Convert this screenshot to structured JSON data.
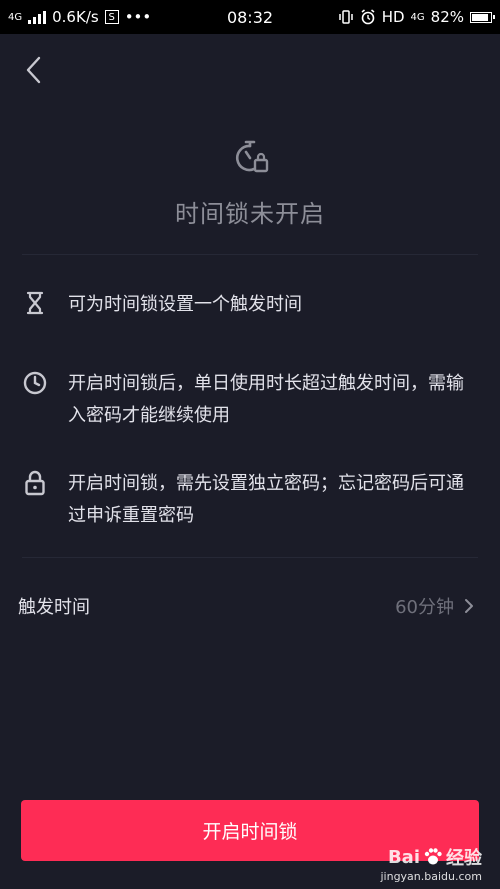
{
  "status_bar": {
    "network_left": "4G",
    "speed": "0.6K/s",
    "sim_icon_text": "S",
    "more": "•••",
    "time": "08:32",
    "hd": "HD",
    "network_right": "4G",
    "battery": "82%"
  },
  "header": {
    "back_icon": "chevron-left-icon"
  },
  "hero": {
    "icon": "timer-lock-icon",
    "title": "时间锁未开启"
  },
  "features": [
    {
      "icon": "hourglass-icon",
      "text": "可为时间锁设置一个触发时间"
    },
    {
      "icon": "clock-icon",
      "text": "开启时间锁后，单日使用时长超过触发时间，需输入密码才能继续使用"
    },
    {
      "icon": "lock-icon",
      "text": "开启时间锁，需先设置独立密码；忘记密码后可通过申诉重置密码"
    }
  ],
  "setting": {
    "label": "触发时间",
    "value": "60分钟",
    "chevron_icon": "chevron-right-icon"
  },
  "primary_button": {
    "label": "开启时间锁"
  },
  "watermark": {
    "brand_left": "Bai",
    "brand_right": "经验",
    "url": "jingyan.baidu.com"
  },
  "colors": {
    "background": "#1b1c28",
    "accent": "#fe2c55",
    "muted_text": "#8d8e98"
  }
}
